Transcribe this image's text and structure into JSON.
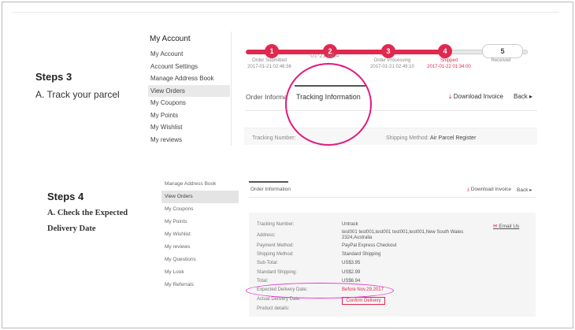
{
  "colors": {
    "accent": "#e0294f",
    "highlight_circle": "#e0197e",
    "highlight_ellipse": "#e62fd4"
  },
  "step3": {
    "title": "Steps 3",
    "subtitle": "A. Track your parcel",
    "sidebar": {
      "heading": "My Account",
      "items": [
        {
          "label": "My Account",
          "active": false
        },
        {
          "label": "Account Settings",
          "active": false
        },
        {
          "label": "Manage Address Book",
          "active": false
        },
        {
          "label": "View Orders",
          "active": true
        },
        {
          "label": "My Coupons",
          "active": false
        },
        {
          "label": "My Points",
          "active": false
        },
        {
          "label": "My Wishlist",
          "active": false
        },
        {
          "label": "My reviews",
          "active": false
        }
      ]
    },
    "progress": {
      "steps": [
        {
          "num": "1",
          "label": "Order Submitted",
          "date": "2017-01-21 02:46:36",
          "done": true
        },
        {
          "num": "2",
          "label": "",
          "date": "",
          "done": true
        },
        {
          "num": "3",
          "label": "Order Processing",
          "date": "2017-01-21 02:49:10",
          "done": true
        },
        {
          "num": "4",
          "label": "Shipped",
          "date": "2017-01-22 01:34:00",
          "done": true
        },
        {
          "num": "5",
          "label": "Received",
          "date": "",
          "done": false
        }
      ],
      "overlay_date": "-01-21 02:4"
    },
    "tabs": {
      "order_info": "Order Informa",
      "tracking_info": "Tracking Information"
    },
    "download_invoice": "Download Invoice",
    "back": "Back",
    "tracking_number_label": "Tracking Number:",
    "shipping_method_label": "Shipping Method:",
    "shipping_method_value": "Air Parcel Register"
  },
  "step4": {
    "title": "Steps 4",
    "subtitle_line1": "A. Check the Expected",
    "subtitle_line2": "Delivery Date",
    "sidebar": {
      "items": [
        {
          "label": "Manage Address Book",
          "active": false
        },
        {
          "label": "View Orders",
          "active": true
        },
        {
          "label": "My Coupons",
          "active": false
        },
        {
          "label": "My Points",
          "active": false
        },
        {
          "label": "My Wishlist",
          "active": false
        },
        {
          "label": "My reviews",
          "active": false
        },
        {
          "label": "My Questions",
          "active": false
        },
        {
          "label": "My Look",
          "active": false
        },
        {
          "label": "My Referrals",
          "active": false
        }
      ]
    },
    "tab_order_info": "Order Information",
    "download_invoice": "Download Invoice",
    "back": "Back",
    "email_us": "Email Us",
    "details": [
      {
        "label": "Tracking Number:",
        "value": "Untrack"
      },
      {
        "label": "Address:",
        "value": "test001 test001,test001 test001,test001,New South Wales 2324,Australia"
      },
      {
        "label": "Payment Method:",
        "value": "PayPal Express Checkout"
      },
      {
        "label": "Shipping Method:",
        "value": "Standard Shipping"
      },
      {
        "label": "Sub-Total:",
        "value": "US$3.95"
      },
      {
        "label": "Standard Shipping:",
        "value": "US$2.99"
      },
      {
        "label": "Total:",
        "value": "US$6.94"
      },
      {
        "label": "Expected Delivery Date:",
        "value": "Before Nov.29,2017"
      },
      {
        "label": "Actual Delivery Date:",
        "value": ""
      },
      {
        "label": "Product details:",
        "value": ""
      }
    ],
    "confirm_delivery": "Confirm Delivery"
  }
}
